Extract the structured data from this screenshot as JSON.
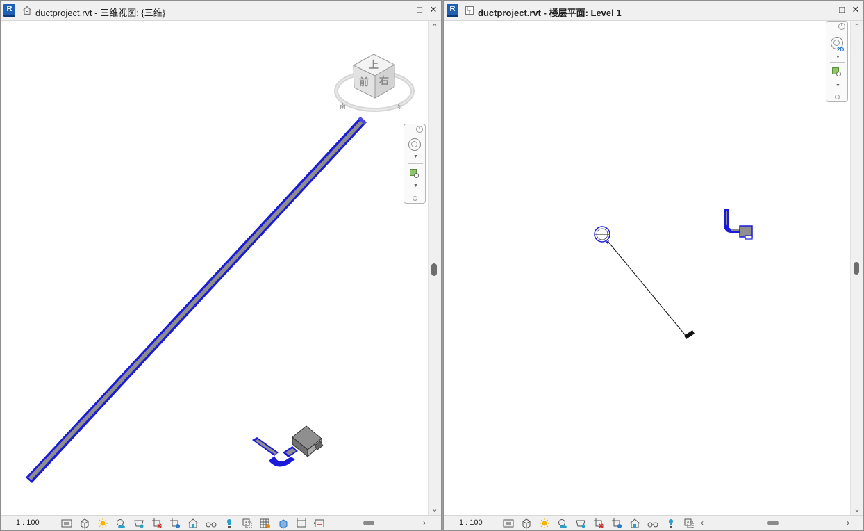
{
  "left_window": {
    "logo": "R",
    "view_icon": "home-3d-icon",
    "title": "ductproject.rvt - 三维视图: {三维}",
    "controls": [
      "minimize",
      "maximize",
      "close"
    ],
    "viewcube": {
      "top": "上",
      "front": "前",
      "right": "右",
      "compass_left": "南",
      "compass_right": "东"
    },
    "scale": "1 : 100",
    "tool_icons": [
      "detail-level-icon",
      "visual-style-icon",
      "sun-path-icon",
      "shadows-icon",
      "render-icon",
      "crop-view-icon",
      "show-crop-icon",
      "lock-3d-icon",
      "temporary-hide-icon",
      "reveal-hidden-icon",
      "worksharing-icon",
      "design-options-icon",
      "analytical-model-icon",
      "highlight-displacement-icon",
      "reveal-constraints-icon"
    ]
  },
  "right_window": {
    "logo": "R",
    "view_icon": "floor-plan-icon",
    "title": "ductproject.rvt - 楼层平面: Level 1",
    "controls": [
      "minimize",
      "maximize",
      "close"
    ],
    "navbar_tag": "2D",
    "scale": "1 : 100",
    "tool_icons": [
      "detail-level-icon",
      "visual-style-icon",
      "sun-path-icon",
      "shadows-icon",
      "crop-view-icon",
      "show-crop-icon",
      "temporary-hide-icon",
      "reveal-hidden-icon",
      "worksharing-icon",
      "design-options-icon",
      "analytical-model-icon"
    ]
  },
  "colors": {
    "duct_blue": "#1a1ad8",
    "duct_gray": "#8d8d8d",
    "r_logo": "#1f5fb4"
  }
}
